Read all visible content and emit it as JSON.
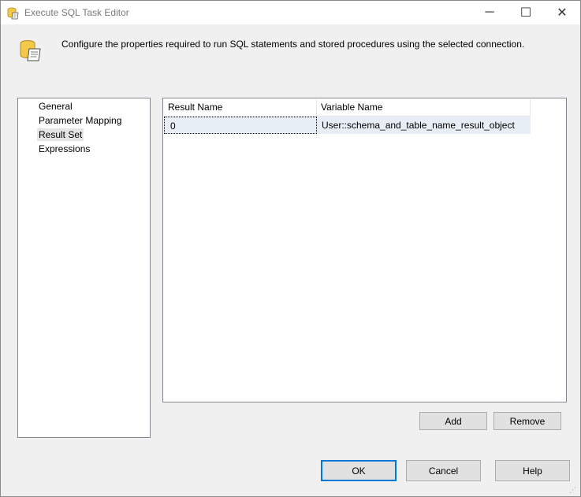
{
  "window": {
    "title": "Execute SQL Task Editor",
    "controls": {
      "minimize": "─",
      "maximize": "☐",
      "close": "✕"
    }
  },
  "header": {
    "description": "Configure the properties required to run SQL statements and stored procedures using the selected connection.",
    "icon": "scroll-database-icon"
  },
  "nav": {
    "items": [
      {
        "label": "General"
      },
      {
        "label": "Parameter Mapping"
      },
      {
        "label": "Result Set",
        "selected": true
      },
      {
        "label": "Expressions"
      }
    ]
  },
  "result_grid": {
    "columns": [
      "Result Name",
      "Variable Name"
    ],
    "rows": [
      {
        "result_name": "0",
        "variable_name": "User::schema_and_table_name_result_object"
      }
    ]
  },
  "grid_buttons": {
    "add": "Add",
    "remove": "Remove"
  },
  "dialog_buttons": {
    "ok": "OK",
    "cancel": "Cancel",
    "help": "Help"
  },
  "colors": {
    "accent": "#0078d7",
    "selection": "#e8eef5"
  }
}
